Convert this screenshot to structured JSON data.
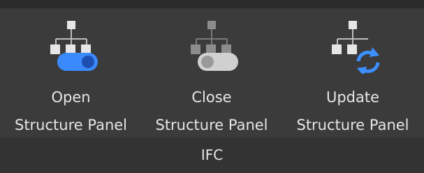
{
  "ribbon": {
    "group_label": "IFC",
    "tools": [
      {
        "line1": "Open",
        "line2": "Structure Panel",
        "icon": "structure-tree-toggle-on-icon",
        "toggle_color": "#3d8fff"
      },
      {
        "line1": "Close",
        "line2": "Structure Panel",
        "icon": "structure-tree-toggle-off-icon",
        "toggle_color": "#d0d0d0"
      },
      {
        "line1": "Update",
        "line2": "Structure Panel",
        "icon": "structure-tree-refresh-icon",
        "refresh_color": "#3d8fff"
      }
    ]
  }
}
